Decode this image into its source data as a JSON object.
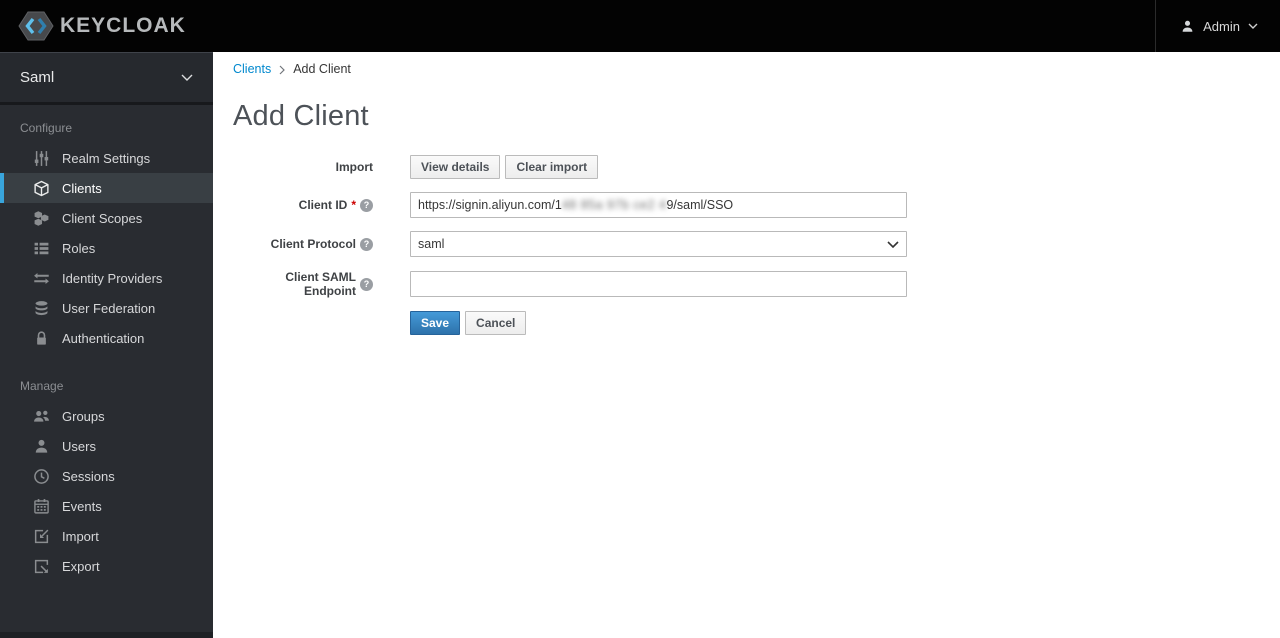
{
  "topbar": {
    "brand": "KEYCLOAK",
    "user": {
      "label": "Admin"
    }
  },
  "sidebar": {
    "realm": "Saml",
    "sections": [
      {
        "label": "Configure",
        "items": [
          {
            "label": "Realm Settings",
            "icon": "sliders-icon",
            "active": false
          },
          {
            "label": "Clients",
            "icon": "cube-icon",
            "active": true
          },
          {
            "label": "Client Scopes",
            "icon": "cubes-icon",
            "active": false
          },
          {
            "label": "Roles",
            "icon": "list-icon",
            "active": false
          },
          {
            "label": "Identity Providers",
            "icon": "exchange-icon",
            "active": false
          },
          {
            "label": "User Federation",
            "icon": "database-icon",
            "active": false
          },
          {
            "label": "Authentication",
            "icon": "lock-icon",
            "active": false
          }
        ]
      },
      {
        "label": "Manage",
        "items": [
          {
            "label": "Groups",
            "icon": "groups-icon",
            "active": false
          },
          {
            "label": "Users",
            "icon": "user-icon",
            "active": false
          },
          {
            "label": "Sessions",
            "icon": "clock-icon",
            "active": false
          },
          {
            "label": "Events",
            "icon": "calendar-icon",
            "active": false
          },
          {
            "label": "Import",
            "icon": "import-icon",
            "active": false
          },
          {
            "label": "Export",
            "icon": "export-icon",
            "active": false
          }
        ]
      }
    ]
  },
  "breadcrumb": {
    "items": [
      {
        "label": "Clients",
        "link": true
      },
      {
        "label": "Add Client",
        "link": false
      }
    ]
  },
  "page": {
    "title": "Add Client"
  },
  "form": {
    "import": {
      "label": "Import",
      "view_details_label": "View details",
      "clear_import_label": "Clear import"
    },
    "client_id": {
      "label": "Client ID",
      "required": true,
      "value_prefix": "https://signin.aliyun.com/1",
      "value_redacted": "48 85a 97b ce2 4",
      "value_suffix": "9/saml/SSO"
    },
    "client_protocol": {
      "label": "Client Protocol",
      "value": "saml"
    },
    "client_saml_endpoint": {
      "label": "Client SAML Endpoint",
      "value": ""
    },
    "actions": {
      "save_label": "Save",
      "cancel_label": "Cancel"
    }
  },
  "colors": {
    "topbar_bg": "#030303",
    "sidebar_bg": "#292c31",
    "active_accent": "#39a5dc",
    "link_blue": "#0088ce",
    "primary_button": "#2d72ab",
    "required_red": "#cc0000"
  }
}
